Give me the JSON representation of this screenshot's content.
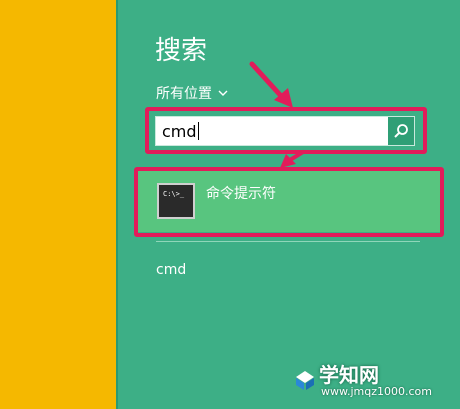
{
  "search": {
    "title": "搜索",
    "scope_label": "所有位置",
    "query": "cmd"
  },
  "results": [
    {
      "label": "命令提示符",
      "icon": "command-prompt-icon",
      "icon_text": "C:\\>_"
    }
  ],
  "suggestions": [
    {
      "label": "cmd"
    }
  ],
  "watermark": {
    "title": "学知网",
    "url": "www.jmqz1000.com"
  },
  "colors": {
    "panel": "#3daf86",
    "left_strip": "#f5b800",
    "highlight_box": "#e21c5a",
    "selected_result": "#58c57f"
  }
}
